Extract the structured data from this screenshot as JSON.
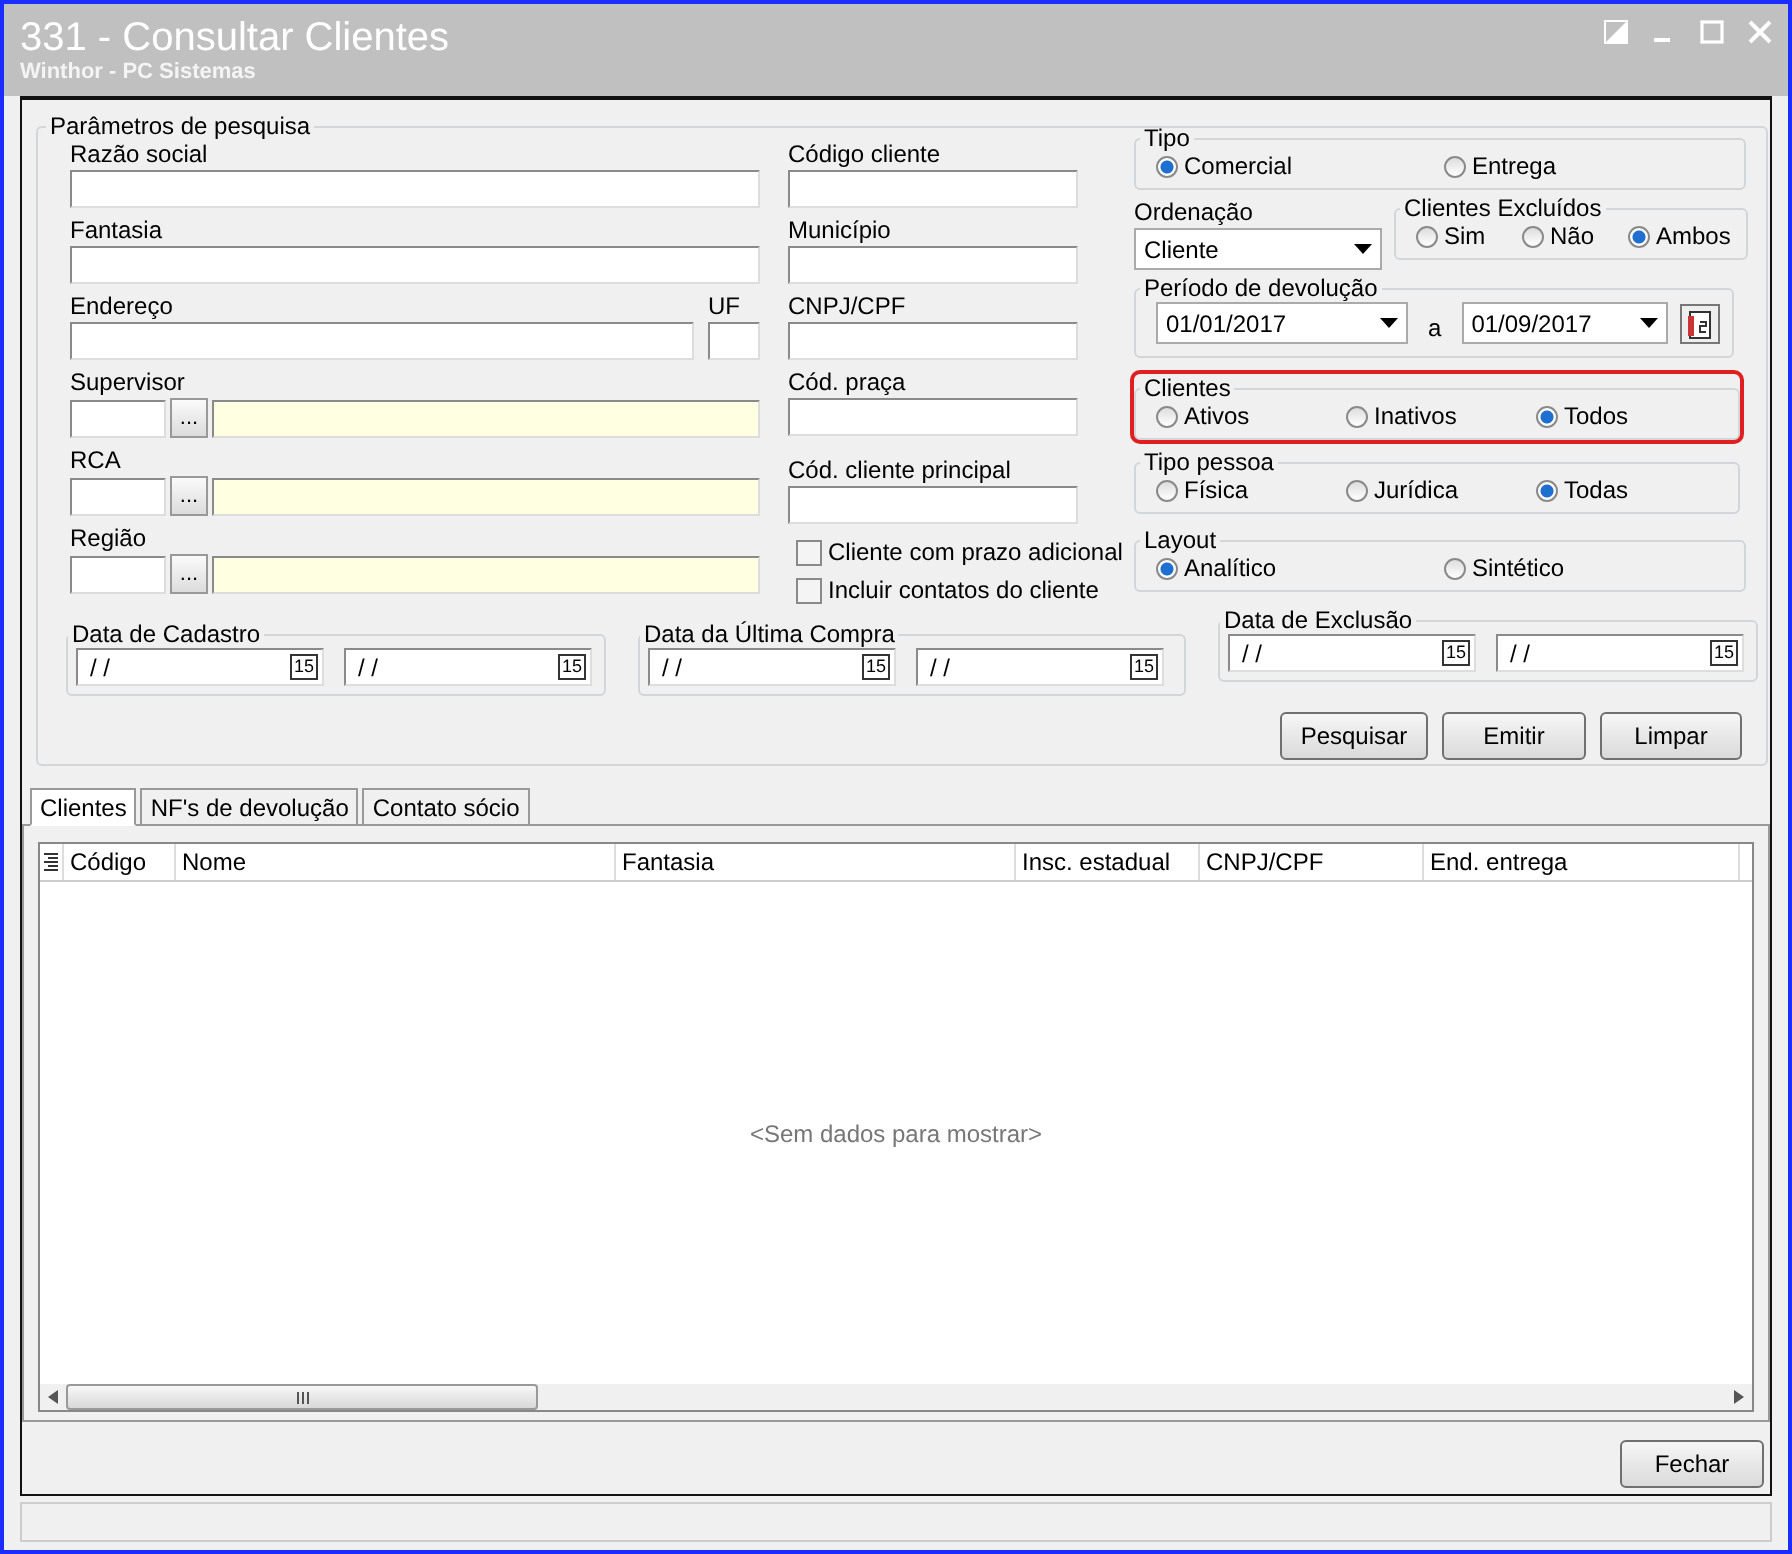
{
  "window": {
    "title": "331 - Consultar Clientes",
    "subtitle": "Winthor - PC Sistemas"
  },
  "search_params": {
    "title": "Parâmetros de pesquisa",
    "left_fields": [
      {
        "kind": "text",
        "label": "Razão social"
      },
      {
        "kind": "text",
        "label": "Fantasia"
      },
      {
        "kind": "address",
        "label": "Endereço",
        "uf_label": "UF"
      },
      {
        "kind": "lookup",
        "label": "Supervisor",
        "button": "..."
      },
      {
        "kind": "lookup",
        "label": "RCA",
        "button": "..."
      },
      {
        "kind": "lookup",
        "label": "Região",
        "button": "..."
      }
    ],
    "middle_fields": [
      {
        "label": "Código cliente"
      },
      {
        "label": "Município"
      },
      {
        "label": "CNPJ/CPF"
      },
      {
        "label": "Cód. praça"
      },
      {
        "label": "Cód. cliente principal"
      }
    ],
    "checkboxes": [
      {
        "label": "Cliente com prazo adicional",
        "checked": false
      },
      {
        "label": "Incluir contatos do cliente",
        "checked": false
      }
    ],
    "tipo": {
      "title": "Tipo",
      "options": [
        {
          "label": "Comercial",
          "selected": true
        },
        {
          "label": "Entrega",
          "selected": false
        }
      ]
    },
    "ordenacao": {
      "label": "Ordenação",
      "value": "Cliente"
    },
    "clientes_excluidos": {
      "title": "Clientes Excluídos",
      "options": [
        {
          "label": "Sim",
          "selected": false
        },
        {
          "label": "Não",
          "selected": false
        },
        {
          "label": "Ambos",
          "selected": true
        }
      ]
    },
    "periodo": {
      "title": "Período de devolução",
      "from": "01/01/2017",
      "separator": "a",
      "to": "01/09/2017"
    },
    "clientes": {
      "title": "Clientes",
      "highlighted": true,
      "options": [
        {
          "label": "Ativos",
          "selected": false
        },
        {
          "label": "Inativos",
          "selected": false
        },
        {
          "label": "Todos",
          "selected": true
        }
      ]
    },
    "tipo_pessoa": {
      "title": "Tipo pessoa",
      "options": [
        {
          "label": "Física",
          "selected": false
        },
        {
          "label": "Jurídica",
          "selected": false
        },
        {
          "label": "Todas",
          "selected": true
        }
      ]
    },
    "layout": {
      "title": "Layout",
      "options": [
        {
          "label": "Analítico",
          "selected": true
        },
        {
          "label": "Sintético",
          "selected": false
        }
      ]
    },
    "date_groups": [
      {
        "title": "Data de Cadastro",
        "fields": [
          {
            "value": "/ /",
            "button": "15"
          },
          {
            "value": "/ /",
            "button": "15"
          }
        ]
      },
      {
        "title": "Data da Última Compra",
        "fields": [
          {
            "value": "/ /",
            "button": "15"
          },
          {
            "value": "/ /",
            "button": "15"
          }
        ]
      },
      {
        "title": "Data de Exclusão",
        "fields": [
          {
            "value": "/ /",
            "button": "15"
          },
          {
            "value": "/ /",
            "button": "15"
          }
        ]
      }
    ],
    "actions": [
      "Pesquisar",
      "Emitir",
      "Limpar"
    ]
  },
  "tabs": [
    {
      "label": "Clientes",
      "selected": true
    },
    {
      "label": "NF's de devolução",
      "selected": false
    },
    {
      "label": "Contato sócio",
      "selected": false
    }
  ],
  "grid": {
    "columns": [
      "Código",
      "Nome",
      "Fantasia",
      "Insc. estadual",
      "CNPJ/CPF",
      "End. entrega"
    ],
    "empty_message": "<Sem dados para mostrar>"
  },
  "footer_buttons": [
    "Fechar"
  ]
}
